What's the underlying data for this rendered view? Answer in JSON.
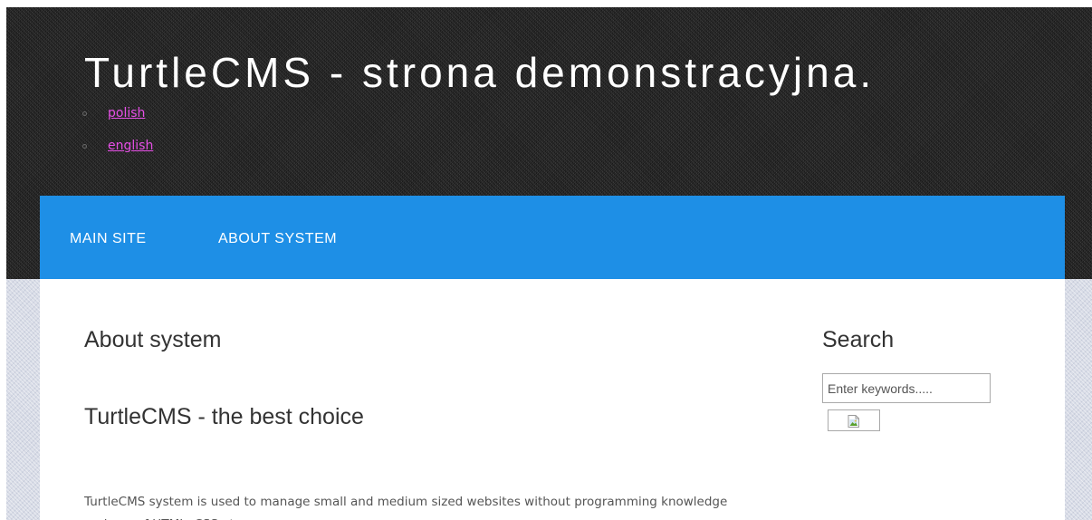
{
  "header": {
    "site_title": "TurtleCMS - strona demonstracyjna.",
    "languages": [
      {
        "label": "polish"
      },
      {
        "label": "english"
      }
    ]
  },
  "nav": {
    "items": [
      {
        "label": "MAIN SITE"
      },
      {
        "label": "ABOUT SYSTEM"
      }
    ]
  },
  "content": {
    "page_heading": "About system",
    "article_heading": "TurtleCMS - the best choice",
    "article_text": "TurtleCMS system is used to manage small and medium sized websites without programming knowledge and use of HTML, CSS etc."
  },
  "sidebar": {
    "search_heading": "Search",
    "search_placeholder": "Enter keywords.....",
    "search_button_icon": "broken-image-icon"
  },
  "colors": {
    "nav_background": "#1e8fe6",
    "link": "#e64fe6",
    "header_background": "#262626"
  }
}
